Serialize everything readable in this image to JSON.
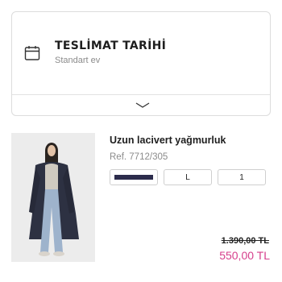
{
  "delivery": {
    "title": "TESLİMAT TARİHİ",
    "subtitle": "Standart ev",
    "icon": "calendar-icon",
    "toggle_icon": "chevron-down-icon"
  },
  "product": {
    "name": "Uzun lacivert yağmurluk",
    "ref": "Ref. 7712/305",
    "color_swatch": "#2c2c4c",
    "size": "L",
    "quantity": "1",
    "old_price": "1.390,00 TL",
    "new_price": "550,00 TL",
    "price_color": "#d63f8c"
  }
}
